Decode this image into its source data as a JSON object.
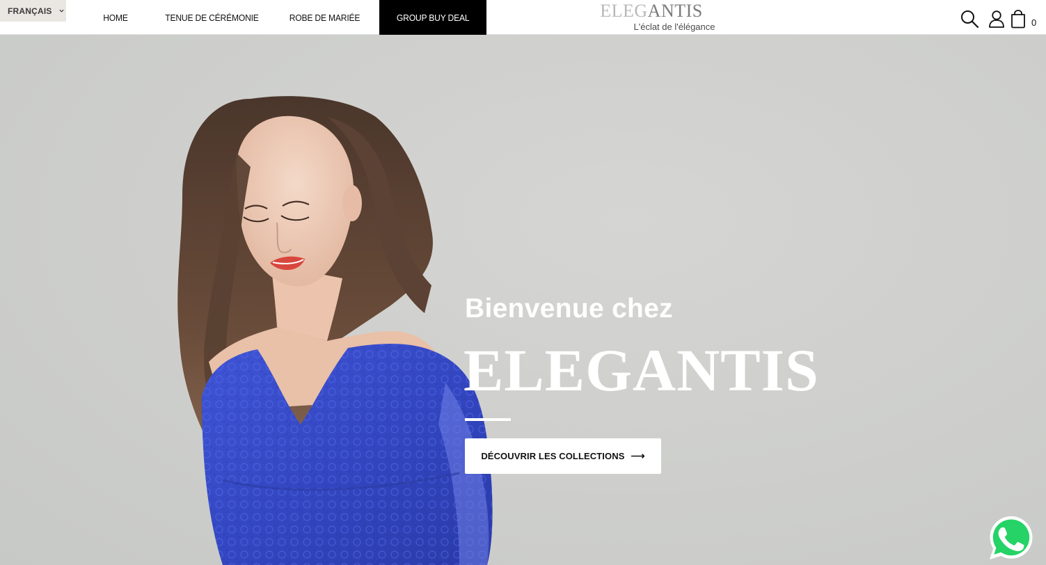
{
  "header": {
    "language": "FRANÇAIS",
    "nav": [
      {
        "label": "HOME"
      },
      {
        "label": "TENUE DE CÉRÉMONIE"
      },
      {
        "label": "ROBE DE MARIÉE"
      },
      {
        "label": "GROUP BUY DEAL",
        "active": true
      }
    ],
    "logo": {
      "word_part1": "ELEG",
      "word_part2": "ANTIS",
      "tagline": "L'éclat de l'élégance"
    },
    "cart_count": "0"
  },
  "hero": {
    "subtitle": "Bienvenue chez",
    "title": "ELEGANTIS",
    "cta_label": "DÉCOUVRIR LES COLLECTIONS",
    "cta_arrow": "⟶"
  },
  "colors": {
    "active_nav_bg": "#000000",
    "lang_bg": "#eae7e3",
    "dress_blue": "#3d4fc9",
    "whatsapp_green": "#25d366"
  },
  "icons": [
    "chevron-down-icon",
    "search-icon",
    "user-icon",
    "cart-icon",
    "whatsapp-icon",
    "arrow-right-icon"
  ]
}
